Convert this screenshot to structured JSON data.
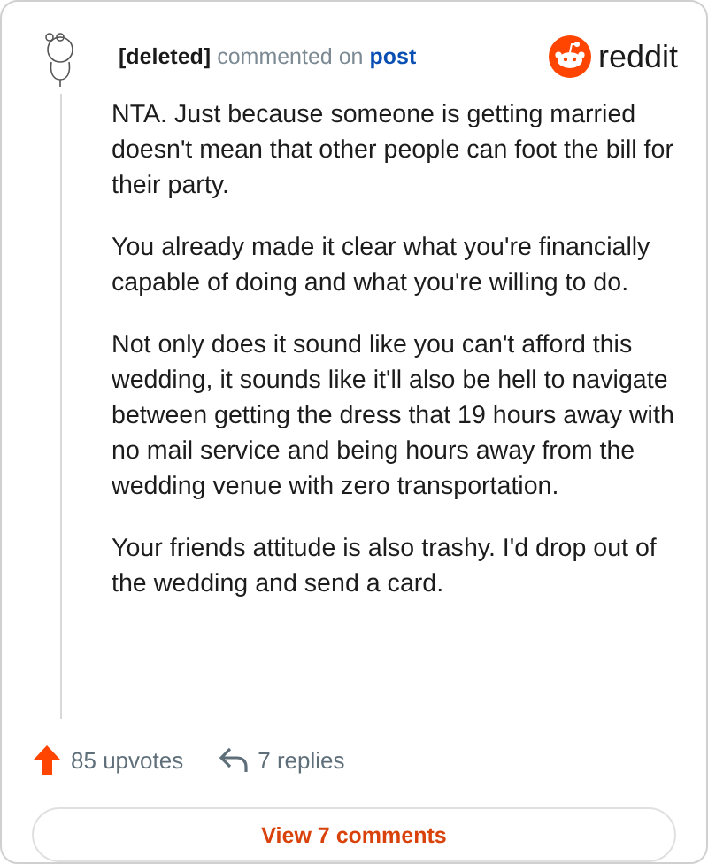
{
  "header": {
    "author": "[deleted]",
    "action": "commented on",
    "link": "post",
    "brand": "reddit"
  },
  "paragraphs": [
    "NTA. Just because someone is getting married doesn't mean that other people can foot the bill for their party.",
    "You already made it clear what you're financially capable of doing and what you're willing to do.",
    "Not only does it sound like you can't afford this wedding, it sounds like it'll also be hell to navigate between getting the dress that 19 hours away with no mail service and being hours away from the wedding venue with zero transportation.",
    "Your friends attitude is also trashy. I'd drop out of the wedding and send a card."
  ],
  "footer": {
    "upvotes": "85 upvotes",
    "replies": "7 replies"
  },
  "button": "View 7 comments"
}
